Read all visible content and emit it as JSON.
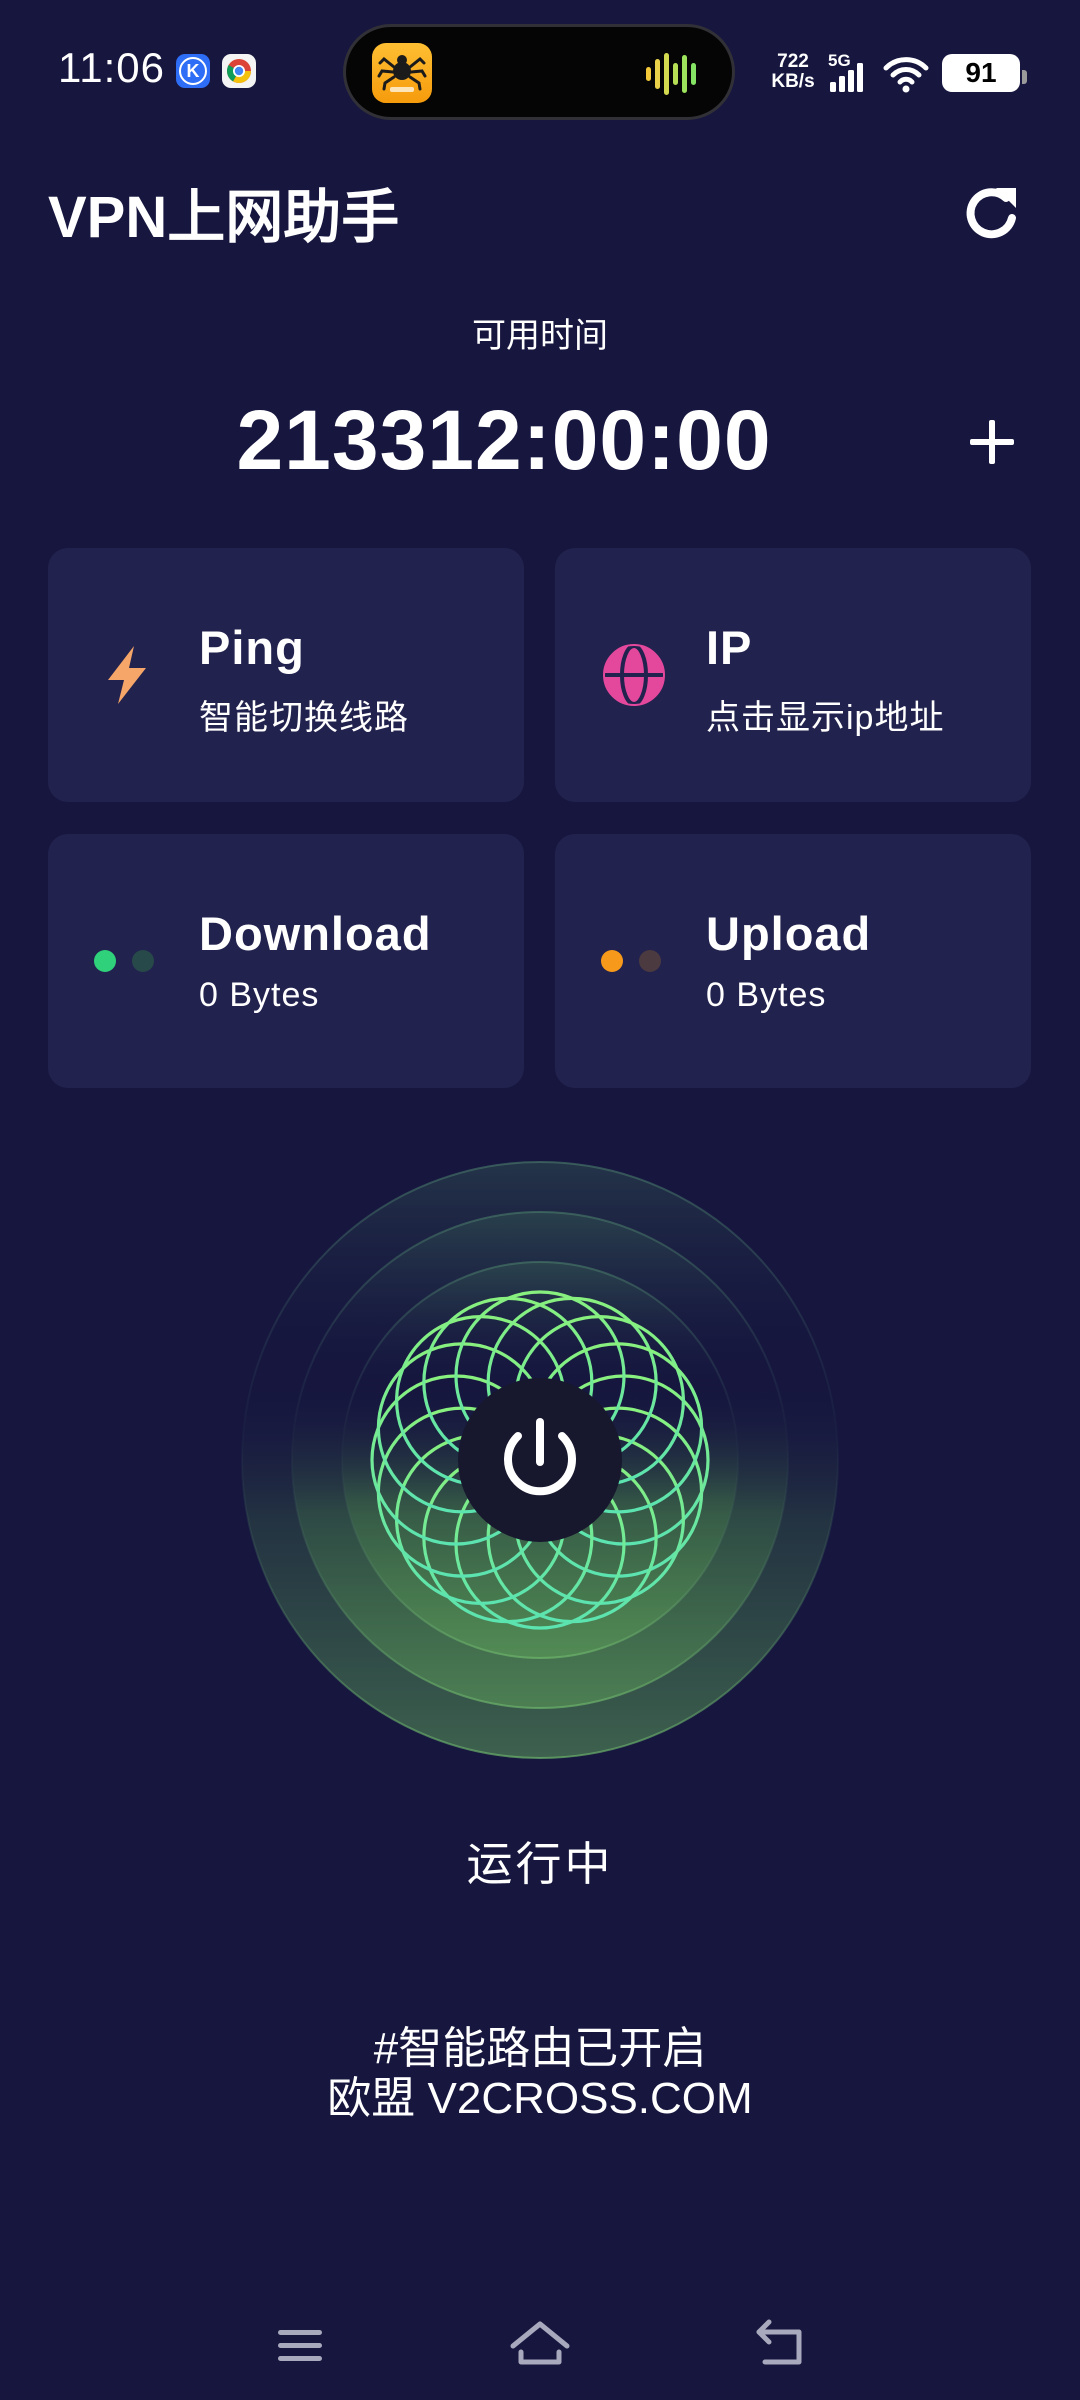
{
  "status_bar": {
    "time": "11:06",
    "net_speed_value": "722",
    "net_speed_unit": "KB/s",
    "network_type": "5G",
    "battery": "91",
    "icons": [
      "k-app-icon",
      "chrome-icon",
      "spider-app-icon",
      "audio-wave-icon",
      "signal-icon",
      "wifi-icon",
      "battery-icon"
    ]
  },
  "header": {
    "title": "VPN上网助手",
    "refresh_icon": "refresh-icon"
  },
  "time": {
    "label": "可用时间",
    "value": "213312:00:00",
    "add_icon": "plus-icon"
  },
  "cards": {
    "ping": {
      "title": "Ping",
      "subtitle": "智能切换线路",
      "icon": "lightning-icon"
    },
    "ip": {
      "title": "IP",
      "subtitle": "点击显示ip地址",
      "icon": "globe-icon"
    },
    "download": {
      "title": "Download",
      "value": "0 Bytes",
      "icon": "dots-icon"
    },
    "upload": {
      "title": "Upload",
      "value": "0 Bytes",
      "icon": "dots-icon"
    }
  },
  "connection": {
    "status": "运行中",
    "power_icon": "power-icon"
  },
  "footer": {
    "line1": "#智能路由已开启",
    "line2": "欧盟 V2CROSS.COM"
  },
  "nav": {
    "icons": [
      "menu-icon",
      "home-icon",
      "back-icon"
    ]
  },
  "colors": {
    "background": "#16163f",
    "card": "#22224e",
    "ping_icon": "#f5a668",
    "ip_icon": "#e3489c",
    "download_dot_active": "#2fd17a",
    "download_dot_inactive": "#27494a",
    "upload_dot_active": "#f7991b",
    "upload_dot_inactive": "#4b3a3f",
    "ring_green": "#7cf29a"
  }
}
